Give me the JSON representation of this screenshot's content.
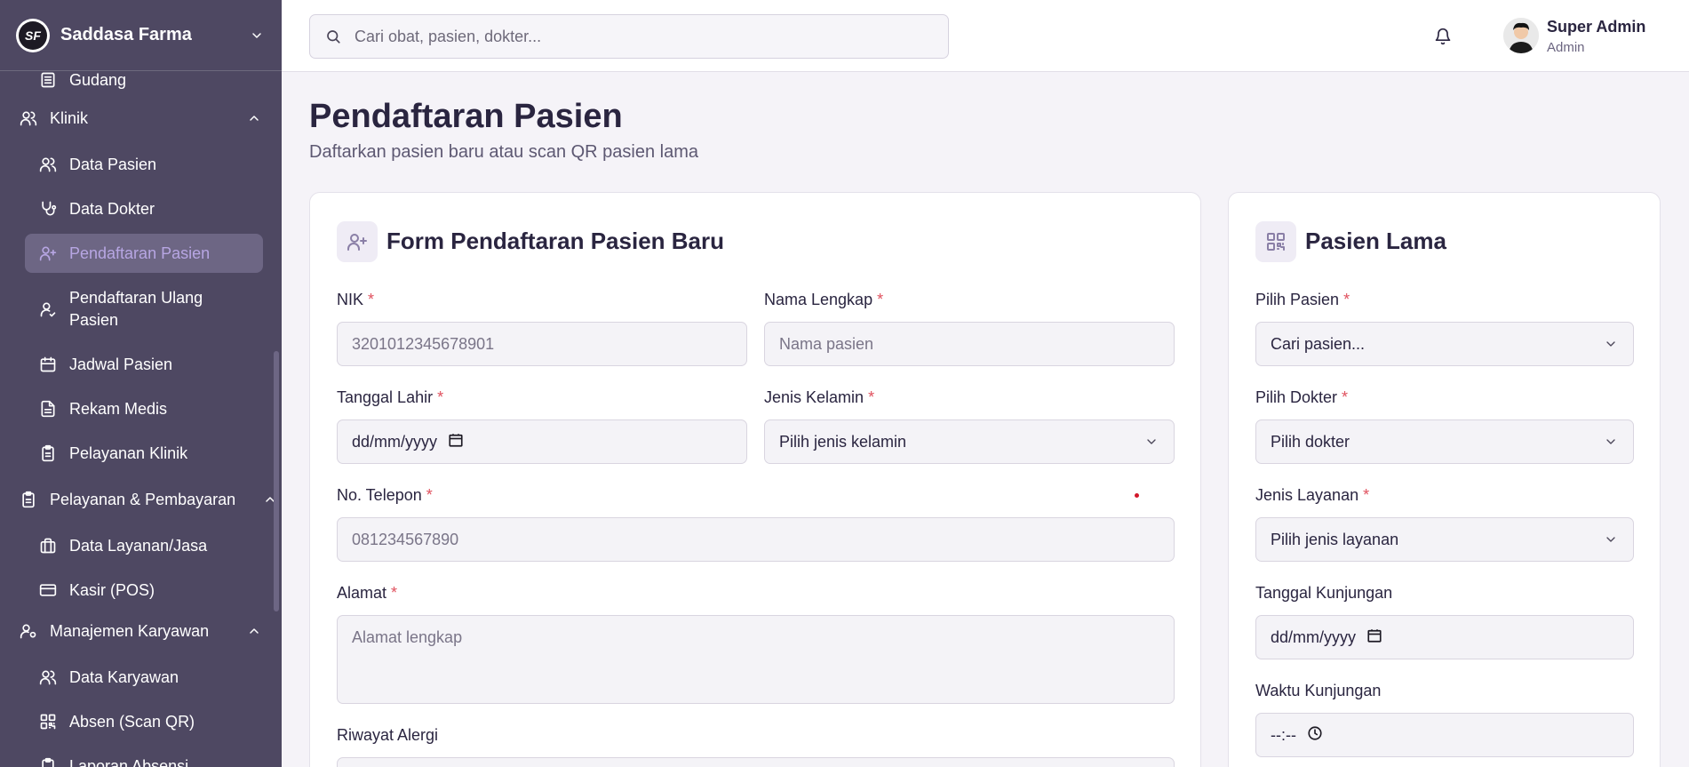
{
  "sidebar": {
    "brand_logo_text": "SF",
    "brand_name": "Saddasa Farma",
    "items": {
      "gudang": "Gudang",
      "klinik": "Klinik",
      "data_pasien": "Data Pasien",
      "data_dokter": "Data Dokter",
      "pendaftaran_pasien": "Pendaftaran Pasien",
      "pendaftaran_ulang_pasien": "Pendaftaran Ulang Pasien",
      "jadwal_pasien": "Jadwal Pasien",
      "rekam_medis": "Rekam Medis",
      "pelayanan_klinik": "Pelayanan Klinik",
      "pelayanan_pembayaran": "Pelayanan & Pembayaran",
      "data_layanan": "Data Layanan/Jasa",
      "kasir": "Kasir (POS)",
      "manajemen_karyawan": "Manajemen Karyawan",
      "data_karyawan": "Data Karyawan",
      "absen": "Absen (Scan QR)",
      "laporan_absensi": "Laporan Absensi"
    }
  },
  "topbar": {
    "search_placeholder": "Cari obat, pasien, dokter...",
    "user_name": "Super Admin",
    "user_role": "Admin"
  },
  "page": {
    "title": "Pendaftaran Pasien",
    "subtitle": "Daftarkan pasien baru atau scan QR pasien lama"
  },
  "form_new": {
    "title": "Form Pendaftaran Pasien Baru",
    "required_mark": "*",
    "nik_label": "NIK",
    "nik_placeholder": "3201012345678901",
    "nama_label": "Nama Lengkap",
    "nama_placeholder": "Nama pasien",
    "tgl_lahir_label": "Tanggal Lahir",
    "tgl_lahir_value": "dd/mm/yyyy",
    "jk_label": "Jenis Kelamin",
    "jk_value": "Pilih jenis kelamin",
    "telp_label": "No. Telepon",
    "telp_placeholder": "081234567890",
    "alamat_label": "Alamat",
    "alamat_placeholder": "Alamat lengkap",
    "alergi_label": "Riwayat Alergi"
  },
  "form_old": {
    "title": "Pasien Lama",
    "pasien_label": "Pilih Pasien",
    "pasien_value": "Cari pasien...",
    "dokter_label": "Pilih Dokter",
    "dokter_value": "Pilih dokter",
    "layanan_label": "Jenis Layanan",
    "layanan_value": "Pilih jenis layanan",
    "tgl_kunjungan_label": "Tanggal Kunjungan",
    "tgl_kunjungan_value": "dd/mm/yyyy",
    "waktu_kunjungan_label": "Waktu Kunjungan",
    "waktu_kunjungan_value": "--:--"
  },
  "colors": {
    "sidebar_bg": "#4e4862",
    "active_item_bg": "#6d6684",
    "active_item_text": "#b7a6e3",
    "required": "#e0515e",
    "page_bg": "#f5f3f8"
  }
}
